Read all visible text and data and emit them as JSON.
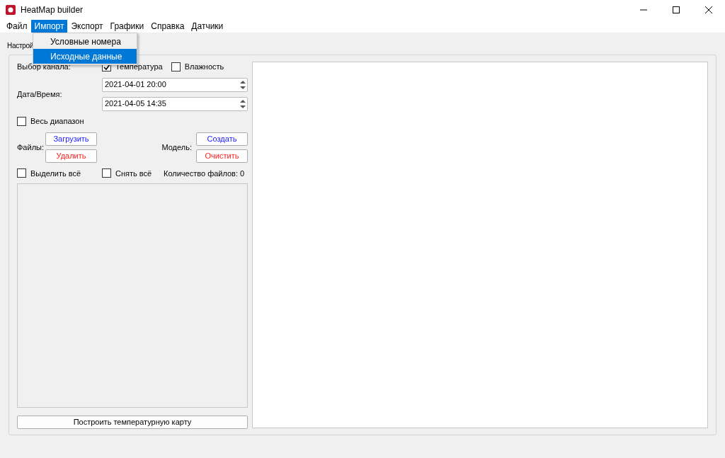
{
  "window": {
    "title": "HeatMap builder"
  },
  "menu": [
    {
      "label": "Файл",
      "selected": false
    },
    {
      "label": "Импорт",
      "selected": true
    },
    {
      "label": "Экспорт",
      "selected": false
    },
    {
      "label": "Графики",
      "selected": false
    },
    {
      "label": "Справка",
      "selected": false
    },
    {
      "label": "Датчики",
      "selected": false
    }
  ],
  "dropdown": [
    {
      "label": "Условные номера",
      "selected": false
    },
    {
      "label": "Исходные данные",
      "selected": true
    }
  ],
  "tab": {
    "label": "Настрой"
  },
  "channel": {
    "label": "Выбор канала:",
    "options": [
      {
        "label": "Температура",
        "checked": true
      },
      {
        "label": "Влажность",
        "checked": false
      }
    ]
  },
  "datetime": {
    "label": "Дата/Время:",
    "start": "2021-04-01 20:00",
    "end": "2021-04-05 14:35"
  },
  "full_range": {
    "label": "Весь диапазон",
    "checked": false
  },
  "files": {
    "label": "Файлы:",
    "buttons": [
      {
        "label": "Загрузить",
        "color": "#2020ff"
      },
      {
        "label": "Удалить",
        "color": "#ff2020"
      }
    ]
  },
  "model": {
    "label": "Модель:",
    "buttons": [
      {
        "label": "Создать",
        "color": "#2020ff"
      },
      {
        "label": "Очистить",
        "color": "#ff2020"
      }
    ]
  },
  "select_all": {
    "label": "Выделить всё",
    "checked": false
  },
  "deselect_all": {
    "label": "Снять всё",
    "checked": false
  },
  "file_count": "Количество файлов: 0",
  "build_button": "Построить температурную карту"
}
